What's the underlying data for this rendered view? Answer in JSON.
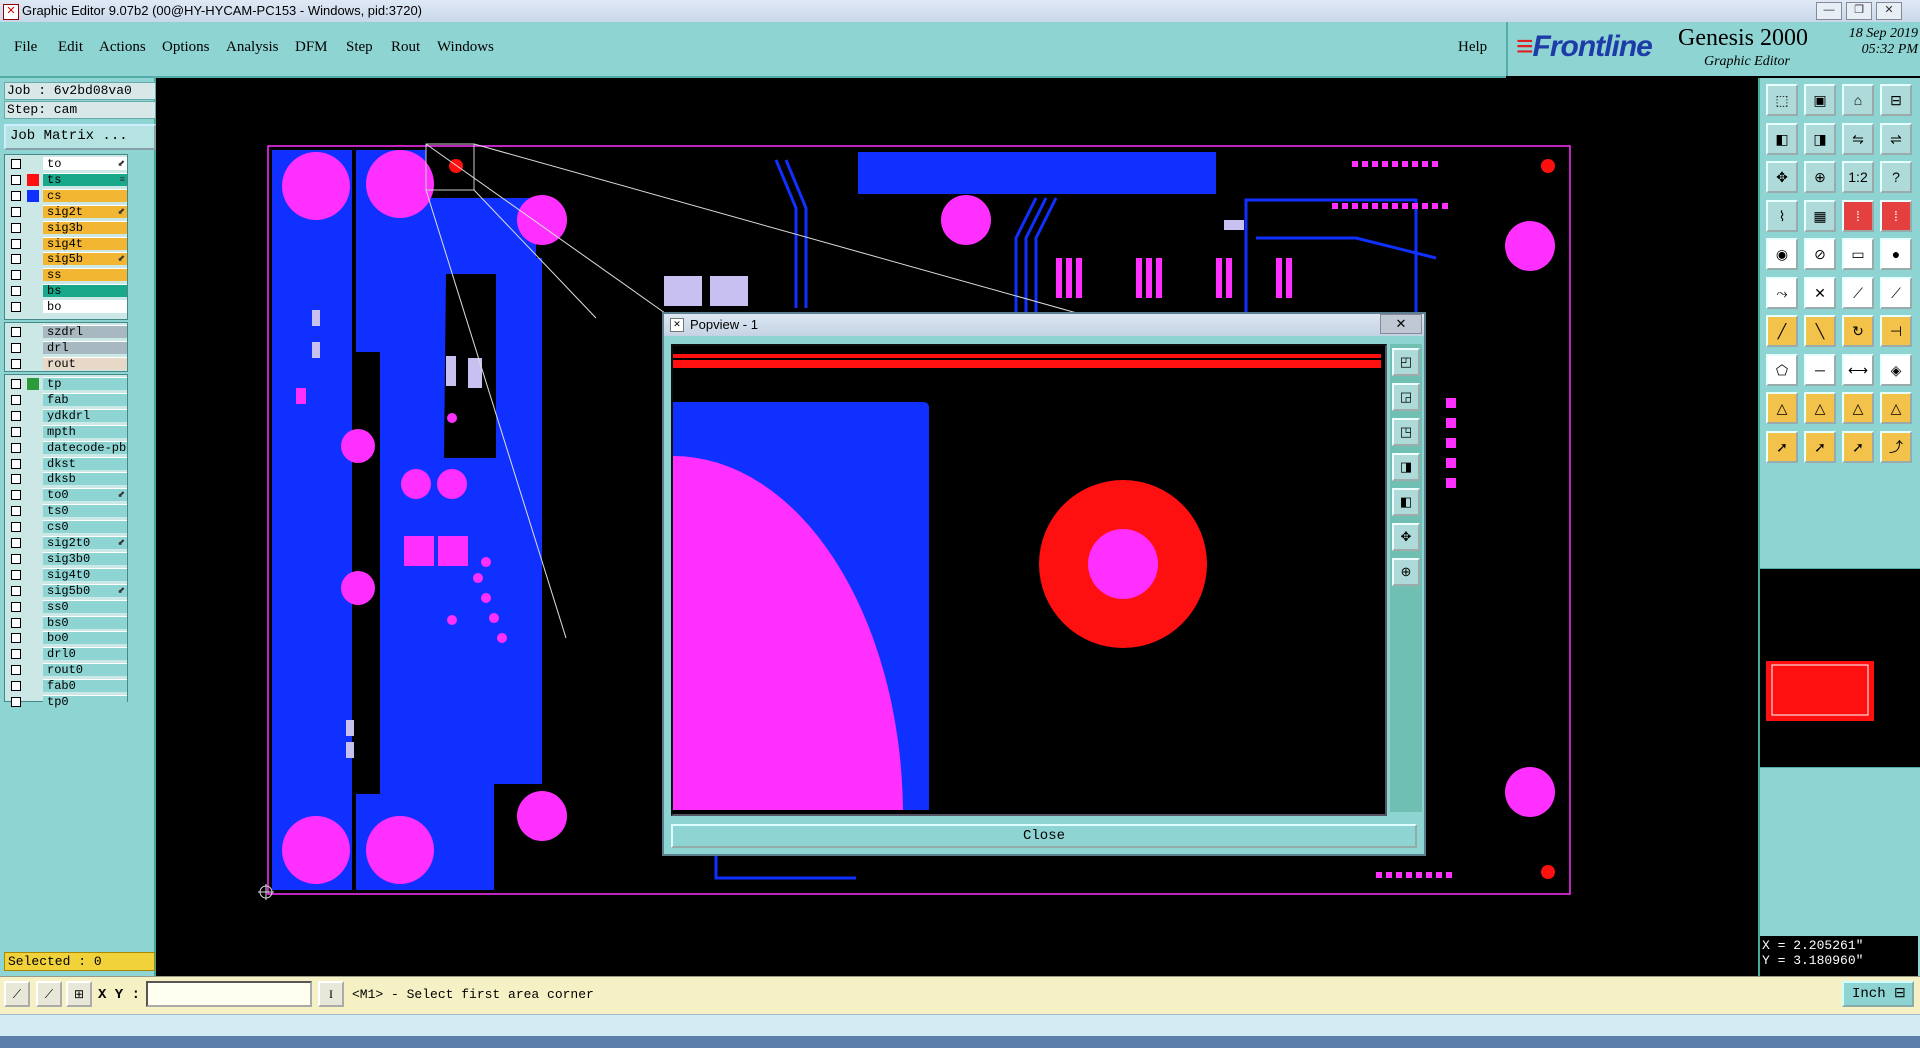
{
  "window": {
    "title": "Graphic Editor 9.07b2 (00@HY-HYCAM-PC153 - Windows, pid:3720)",
    "controls": [
      "—",
      "❐",
      "✕"
    ]
  },
  "menu": {
    "items": [
      "File",
      "Edit",
      "Actions",
      "Options",
      "Analysis",
      "DFM",
      "Step",
      "Rout",
      "Windows"
    ],
    "help": "Help"
  },
  "brand": {
    "logo_prefix": "≡",
    "logo": "Frontline",
    "product": "Genesis 2000",
    "subtitle": "Graphic Editor",
    "date": "18 Sep 2019",
    "time": "05:32 PM"
  },
  "job": {
    "job_line": "Job : 6v2bd08va0",
    "step_line": "Step: cam",
    "matrix_button": "Job Matrix ..."
  },
  "layers_group1": [
    {
      "name": "to",
      "color": "#ffffff",
      "swatch": "",
      "mark": "⬋"
    },
    {
      "name": "ts",
      "color": "#1aa88a",
      "swatch": "#ff1010",
      "mark": "≡"
    },
    {
      "name": "cs",
      "color": "#f2b632",
      "swatch": "#1030ff",
      "mark": ""
    },
    {
      "name": "sig2t",
      "color": "#f2b632",
      "swatch": "",
      "mark": "⬋"
    },
    {
      "name": "sig3b",
      "color": "#f2b632",
      "swatch": "",
      "mark": ""
    },
    {
      "name": "sig4t",
      "color": "#f2b632",
      "swatch": "",
      "mark": ""
    },
    {
      "name": "sig5b",
      "color": "#f2b632",
      "swatch": "",
      "mark": "⬋"
    },
    {
      "name": "ss",
      "color": "#f2b632",
      "swatch": "",
      "mark": ""
    },
    {
      "name": "bs",
      "color": "#1aa88a",
      "swatch": "",
      "mark": ""
    },
    {
      "name": "bo",
      "color": "#ffffff",
      "swatch": "",
      "mark": ""
    }
  ],
  "layers_group2": [
    {
      "name": "szdrl",
      "color": "#a8b8c0",
      "swatch": "",
      "mark": ""
    },
    {
      "name": "drl",
      "color": "#a8b8c0",
      "swatch": "",
      "mark": ""
    },
    {
      "name": "rout",
      "color": "#e8d8c8",
      "swatch": "",
      "mark": ""
    }
  ],
  "layers_group3": [
    {
      "name": "tp",
      "color": "#8ed4d2",
      "swatch": "#2a9a3a",
      "mark": ""
    },
    {
      "name": "fab",
      "color": "#8ed4d2",
      "swatch": "",
      "mark": ""
    },
    {
      "name": "ydkdrl",
      "color": "#8ed4d2",
      "swatch": "",
      "mark": ""
    },
    {
      "name": "mpth",
      "color": "#8ed4d2",
      "swatch": "",
      "mark": ""
    },
    {
      "name": "datecode-pb",
      "color": "#8ed4d2",
      "swatch": "",
      "mark": ""
    },
    {
      "name": "dkst",
      "color": "#8ed4d2",
      "swatch": "",
      "mark": ""
    },
    {
      "name": "dksb",
      "color": "#8ed4d2",
      "swatch": "",
      "mark": ""
    },
    {
      "name": "to0",
      "color": "#8ed4d2",
      "swatch": "",
      "mark": "⬋"
    },
    {
      "name": "ts0",
      "color": "#8ed4d2",
      "swatch": "",
      "mark": ""
    },
    {
      "name": "cs0",
      "color": "#8ed4d2",
      "swatch": "",
      "mark": ""
    },
    {
      "name": "sig2t0",
      "color": "#8ed4d2",
      "swatch": "",
      "mark": "⬋"
    },
    {
      "name": "sig3b0",
      "color": "#8ed4d2",
      "swatch": "",
      "mark": ""
    },
    {
      "name": "sig4t0",
      "color": "#8ed4d2",
      "swatch": "",
      "mark": ""
    },
    {
      "name": "sig5b0",
      "color": "#8ed4d2",
      "swatch": "",
      "mark": "⬋"
    },
    {
      "name": "ss0",
      "color": "#8ed4d2",
      "swatch": "",
      "mark": ""
    },
    {
      "name": "bs0",
      "color": "#8ed4d2",
      "swatch": "",
      "mark": ""
    },
    {
      "name": "bo0",
      "color": "#8ed4d2",
      "swatch": "",
      "mark": ""
    },
    {
      "name": "drl0",
      "color": "#8ed4d2",
      "swatch": "",
      "mark": ""
    },
    {
      "name": "rout0",
      "color": "#8ed4d2",
      "swatch": "",
      "mark": ""
    },
    {
      "name": "fab0",
      "color": "#8ed4d2",
      "swatch": "",
      "mark": ""
    },
    {
      "name": "tp0",
      "color": "#8ed4d2",
      "swatch": "",
      "mark": ""
    }
  ],
  "selected": "Selected : 0",
  "toolbar_icons": [
    "open-job-icon",
    "save-icon",
    "home-icon",
    "layout-icon",
    "copy-left-icon",
    "copy-right-icon",
    "mirror-icon",
    "flip-icon",
    "zoom-fit-icon",
    "zoom-in-icon",
    "one-to-two-icon",
    "help-icon",
    "measure-icon",
    "grid-icon",
    "snap-icon",
    "snap-off-icon",
    "pad-icon",
    "slash-icon",
    "ruler-icon",
    "circle-icon",
    "connect-icon",
    "cross-icon",
    "line-pad-icon",
    "line-pad2-icon",
    "line-icon",
    "diagonal-icon",
    "arc-icon",
    "split-icon",
    "polygon-icon",
    "minus-icon",
    "dimension-icon",
    "shape-icon",
    "triangle-icon",
    "triangle2-icon",
    "triangle3-icon",
    "triangle4-icon",
    "select-icon",
    "select-orange-icon",
    "select-edit-icon",
    "route-icon"
  ],
  "toolbar_glyphs": [
    "⬚",
    "▣",
    "⌂",
    "⊟",
    "◧",
    "◨",
    "⇋",
    "⇌",
    "✥",
    "⊕",
    "1:2",
    "?",
    "⌇",
    "▦",
    "⁞",
    "⁞",
    "◉",
    "⊘",
    "▭",
    "●",
    "⤳",
    "✕",
    "⟋",
    "⟋",
    "╱",
    "╲",
    "↻",
    "⊣",
    "⬠",
    "─",
    "⟷",
    "◈",
    "△",
    "△",
    "△",
    "△",
    "➚",
    "➚",
    "➚",
    "⤴"
  ],
  "popview": {
    "title": "Popview - 1",
    "close_x": "✕",
    "close_label": "Close",
    "tools": [
      "◰",
      "◲",
      "◳",
      "◨",
      "◧",
      "✥",
      "⊕"
    ]
  },
  "coords": {
    "x": "X = 2.205261\"",
    "y": "Y = 3.180960\""
  },
  "bottom": {
    "xy_label": "X Y :",
    "xy_value": "",
    "message": "<M1> - Select first area corner",
    "unit": "Inch ⊟",
    "tool_glyphs": [
      "⟋",
      "⟋",
      "⊞"
    ]
  },
  "colors": {
    "panel": "#8ed4d2",
    "copper_blue": "#1030ff",
    "pad_magenta": "#ff30ff",
    "red": "#ff1010"
  }
}
